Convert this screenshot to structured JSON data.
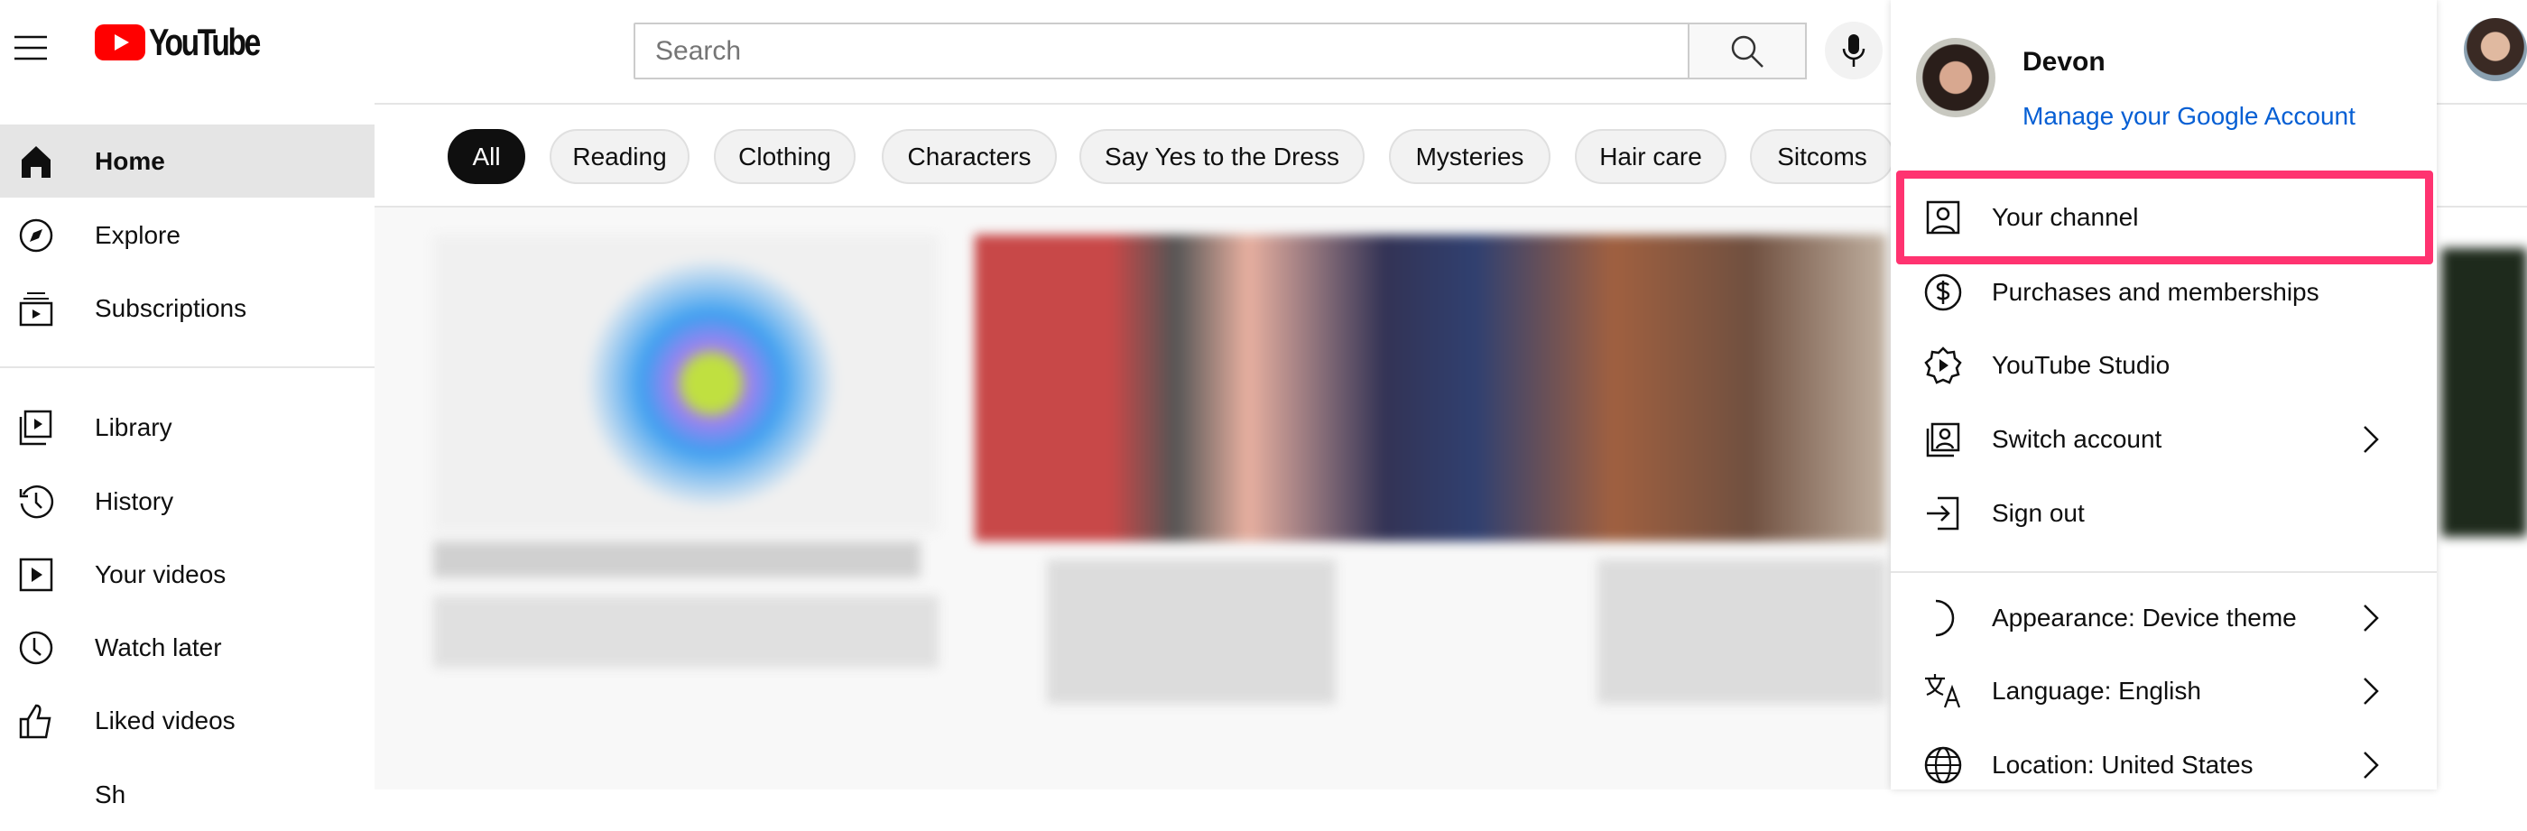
{
  "header": {
    "logo_text": "YouTube",
    "search_placeholder": "Search"
  },
  "sidebar": {
    "items": [
      {
        "label": "Home",
        "icon": "home-icon",
        "active": true
      },
      {
        "label": "Explore",
        "icon": "compass-icon"
      },
      {
        "label": "Subscriptions",
        "icon": "subscriptions-icon"
      },
      {
        "label": "Library",
        "icon": "library-icon"
      },
      {
        "label": "History",
        "icon": "history-icon"
      },
      {
        "label": "Your videos",
        "icon": "your-videos-icon"
      },
      {
        "label": "Watch later",
        "icon": "clock-icon"
      },
      {
        "label": "Liked videos",
        "icon": "thumbs-up-icon"
      },
      {
        "label": "Sh",
        "icon": "chevron-down-icon"
      }
    ]
  },
  "chips": [
    "All",
    "Reading",
    "Clothing",
    "Characters",
    "Say Yes to the Dress",
    "Mysteries",
    "Hair care",
    "Sitcoms"
  ],
  "account_menu": {
    "name": "Devon",
    "manage_link": "Manage your Google Account",
    "items": [
      {
        "label": "Your channel",
        "icon": "channel-icon",
        "highlighted": true
      },
      {
        "label": "Purchases and memberships",
        "icon": "dollar-icon"
      },
      {
        "label": "YouTube Studio",
        "icon": "studio-icon"
      },
      {
        "label": "Switch account",
        "icon": "switch-account-icon",
        "submenu": true
      },
      {
        "label": "Sign out",
        "icon": "sign-out-icon"
      },
      {
        "label": "Appearance: Device theme",
        "icon": "moon-icon",
        "submenu": true
      },
      {
        "label": "Language: English",
        "icon": "translate-icon",
        "submenu": true
      },
      {
        "label": "Location: United States",
        "icon": "globe-icon",
        "submenu": true
      }
    ]
  },
  "colors": {
    "brand": "#ff0000",
    "link": "#065fd4",
    "highlight": "#ff3370"
  }
}
